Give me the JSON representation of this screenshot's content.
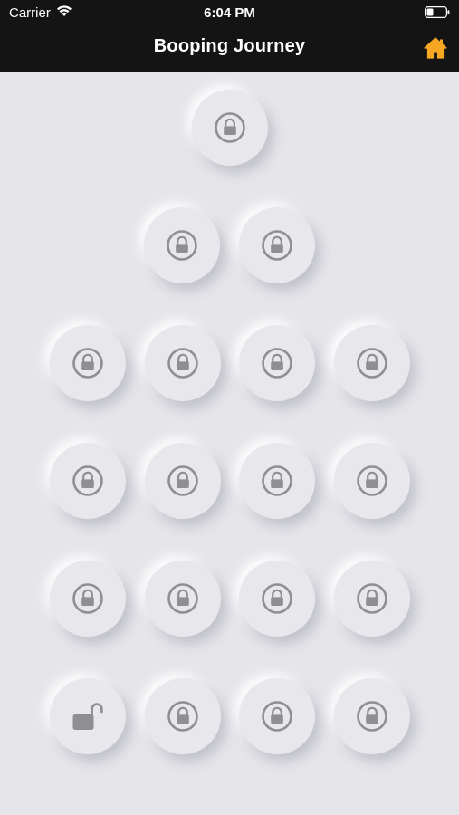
{
  "status_bar": {
    "carrier": "Carrier",
    "time": "6:04 PM"
  },
  "nav": {
    "title": "Booping Journey",
    "home_icon": "home-icon",
    "accent": "#f5a623"
  },
  "levels": [
    {
      "row": 1,
      "locked": true
    },
    {
      "row": 2,
      "locked": true
    },
    {
      "row": 2,
      "locked": true
    },
    {
      "row": 3,
      "locked": true
    },
    {
      "row": 3,
      "locked": true
    },
    {
      "row": 3,
      "locked": true
    },
    {
      "row": 3,
      "locked": true
    },
    {
      "row": 4,
      "locked": true
    },
    {
      "row": 4,
      "locked": true
    },
    {
      "row": 4,
      "locked": true
    },
    {
      "row": 4,
      "locked": true
    },
    {
      "row": 5,
      "locked": true
    },
    {
      "row": 5,
      "locked": true
    },
    {
      "row": 5,
      "locked": true
    },
    {
      "row": 5,
      "locked": true
    },
    {
      "row": 6,
      "locked": false
    },
    {
      "row": 6,
      "locked": true
    },
    {
      "row": 6,
      "locked": true
    },
    {
      "row": 6,
      "locked": true
    }
  ],
  "icons": {
    "locked": "lock-circle-icon",
    "unlocked": "unlocked-padlock-icon",
    "icon_color": "#8e8e93"
  }
}
